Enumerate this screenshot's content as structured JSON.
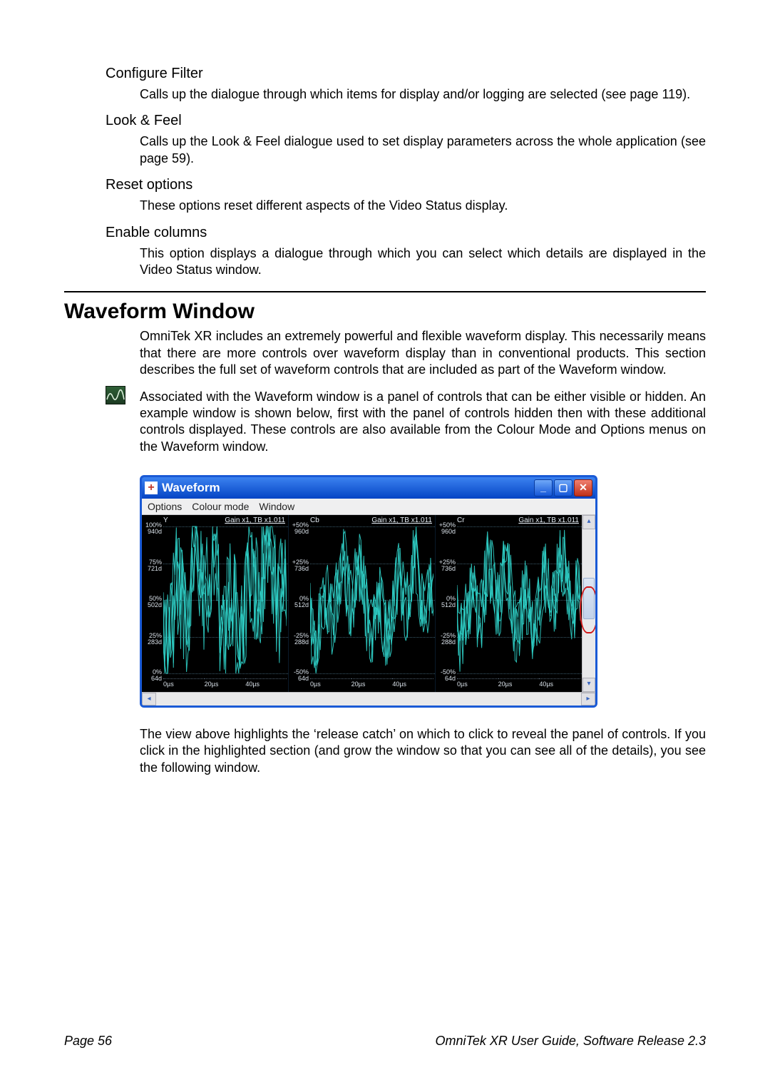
{
  "sections": {
    "configure_filter": {
      "heading": "Configure Filter",
      "text": "Calls up the dialogue through which items for display and/or logging are selected (see page 119)."
    },
    "look_feel": {
      "heading": "Look & Feel",
      "text": "Calls up the Look & Feel dialogue used to set display parameters across the whole application (see page 59)."
    },
    "reset_options": {
      "heading": "Reset options",
      "text": "These options reset different aspects of the Video Status display."
    },
    "enable_columns": {
      "heading": "Enable columns",
      "text": "This option displays a dialogue through which you can select which details are displayed in the Video Status window."
    }
  },
  "waveform": {
    "title": "Waveform Window",
    "para1": "OmniTek XR includes an extremely powerful and flexible waveform display. This necessarily means that there are more controls over waveform display than in conventional products. This section describes the full set of waveform controls that are included as part of the Waveform window.",
    "para2": "Associated with the Waveform window is a panel of controls that can be either visible or hidden. An example window is shown below, first with the panel of controls hidden then with these additional controls displayed. These controls are also available from the Colour Mode and Options menus on the Waveform window.",
    "para3": "The view above highlights the ‘release catch’ on which to click to reveal the panel of controls. If you click in the highlighted section (and grow the window so that you can see all of the details), you see the following window."
  },
  "window": {
    "title": "Waveform",
    "menus": [
      "Options",
      "Colour mode",
      "Window"
    ],
    "plots": [
      {
        "channel": "Y",
        "gain": "Gain x1, TB x1.011",
        "y_ticks": [
          {
            "pct": "100%",
            "d": "940d"
          },
          {
            "pct": "75%",
            "d": "721d"
          },
          {
            "pct": "50%",
            "d": "502d"
          },
          {
            "pct": "25%",
            "d": "283d"
          },
          {
            "pct": "0%",
            "d": "64d"
          }
        ],
        "x_ticks": [
          "0µs",
          "20µs",
          "40µs"
        ]
      },
      {
        "channel": "Cb",
        "gain": "Gain x1, TB x1.011",
        "y_ticks": [
          {
            "pct": "+50%",
            "d": "960d"
          },
          {
            "pct": "+25%",
            "d": "736d"
          },
          {
            "pct": "0%",
            "d": "512d"
          },
          {
            "pct": "-25%",
            "d": "288d"
          },
          {
            "pct": "-50%",
            "d": "64d"
          }
        ],
        "x_ticks": [
          "0µs",
          "20µs",
          "40µs"
        ]
      },
      {
        "channel": "Cr",
        "gain": "Gain x1, TB x1.011",
        "y_ticks": [
          {
            "pct": "+50%",
            "d": "960d"
          },
          {
            "pct": "+25%",
            "d": "736d"
          },
          {
            "pct": "0%",
            "d": "512d"
          },
          {
            "pct": "-25%",
            "d": "288d"
          },
          {
            "pct": "-50%",
            "d": "64d"
          }
        ],
        "x_ticks": [
          "0µs",
          "20µs",
          "40µs"
        ]
      }
    ]
  },
  "footer": {
    "left": "Page 56",
    "right": "OmniTek XR User Guide, Software Release 2.3"
  },
  "chart_data": {
    "type": "line",
    "title": "Waveform",
    "xlabel": "µs",
    "x_range": [
      0,
      50
    ],
    "x_ticks": [
      0,
      20,
      40
    ],
    "series": [
      {
        "name": "Y",
        "ylabel_left": "%",
        "ylabel_right": "digital",
        "ylim_pct": [
          0,
          100
        ],
        "ylim_d": [
          64,
          940
        ],
        "y_ticks_pct": [
          0,
          25,
          50,
          75,
          100
        ],
        "y_ticks_d": [
          64,
          283,
          502,
          721,
          940
        ],
        "gain": "x1",
        "timebase": "x1.011",
        "note": "noisy signal roughly spanning 0–100% across 0–50µs"
      },
      {
        "name": "Cb",
        "ylabel_left": "%",
        "ylabel_right": "digital",
        "ylim_pct": [
          -50,
          50
        ],
        "ylim_d": [
          64,
          960
        ],
        "y_ticks_pct": [
          -50,
          -25,
          0,
          25,
          50
        ],
        "y_ticks_d": [
          64,
          288,
          512,
          736,
          960
        ],
        "gain": "x1",
        "timebase": "x1.011",
        "note": "noisy signal roughly centred around 0% across 0–50µs"
      },
      {
        "name": "Cr",
        "ylabel_left": "%",
        "ylabel_right": "digital",
        "ylim_pct": [
          -50,
          50
        ],
        "ylim_d": [
          64,
          960
        ],
        "y_ticks_pct": [
          -50,
          -25,
          0,
          25,
          50
        ],
        "y_ticks_d": [
          64,
          288,
          512,
          736,
          960
        ],
        "gain": "x1",
        "timebase": "x1.011",
        "note": "noisy signal roughly centred around 0% across 0–50µs"
      }
    ]
  }
}
